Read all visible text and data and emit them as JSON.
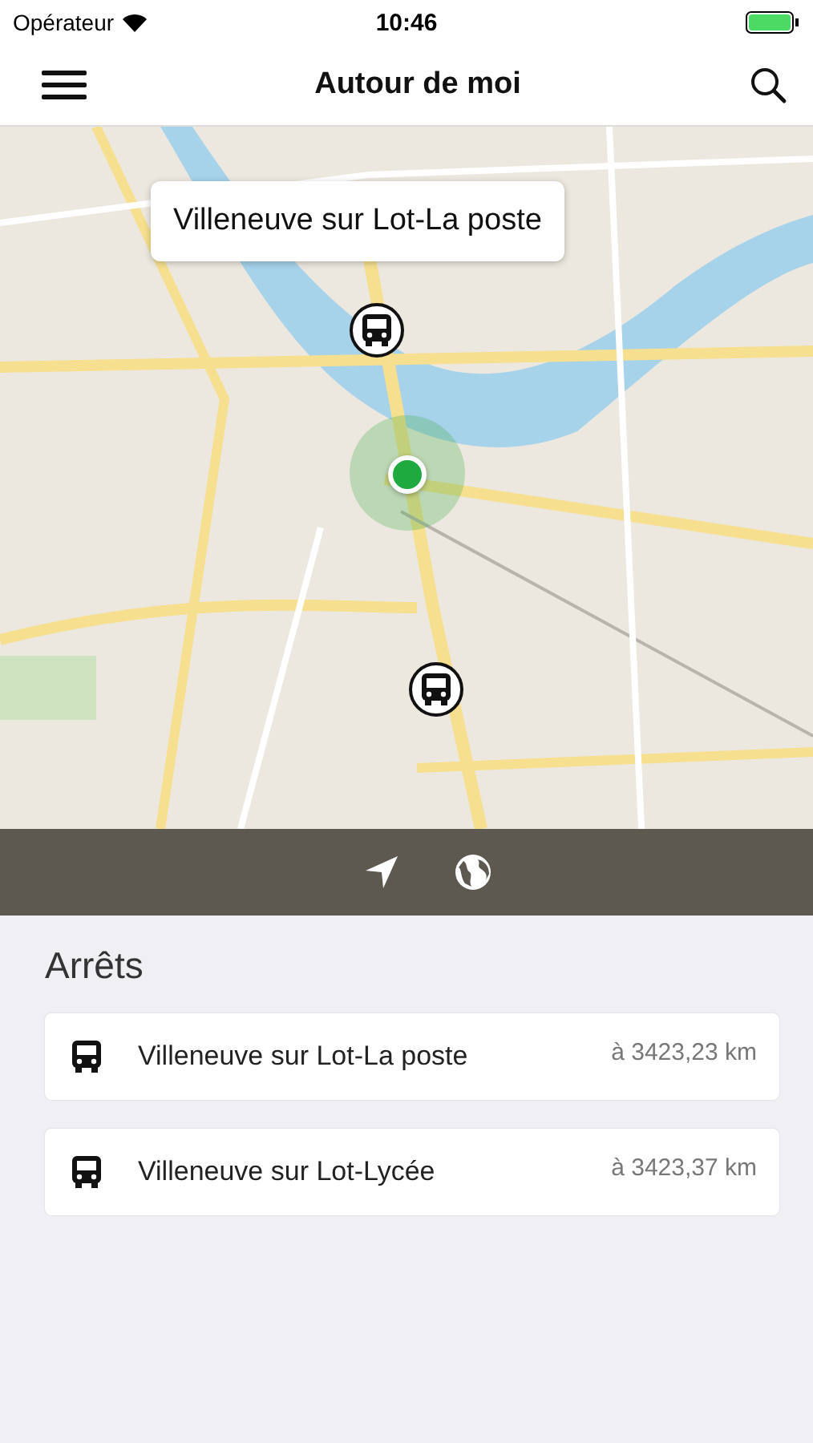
{
  "status_bar": {
    "carrier": "Opérateur",
    "time": "10:46"
  },
  "nav": {
    "title": "Autour de moi"
  },
  "map": {
    "callout": "Villeneuve sur Lot-La poste"
  },
  "section_title": "Arrêts",
  "stops": [
    {
      "name": "Villeneuve sur Lot-La poste",
      "distance": "à 3423,23 km"
    },
    {
      "name": "Villeneuve sur Lot-Lycée",
      "distance": "à 3423,37 km"
    }
  ]
}
